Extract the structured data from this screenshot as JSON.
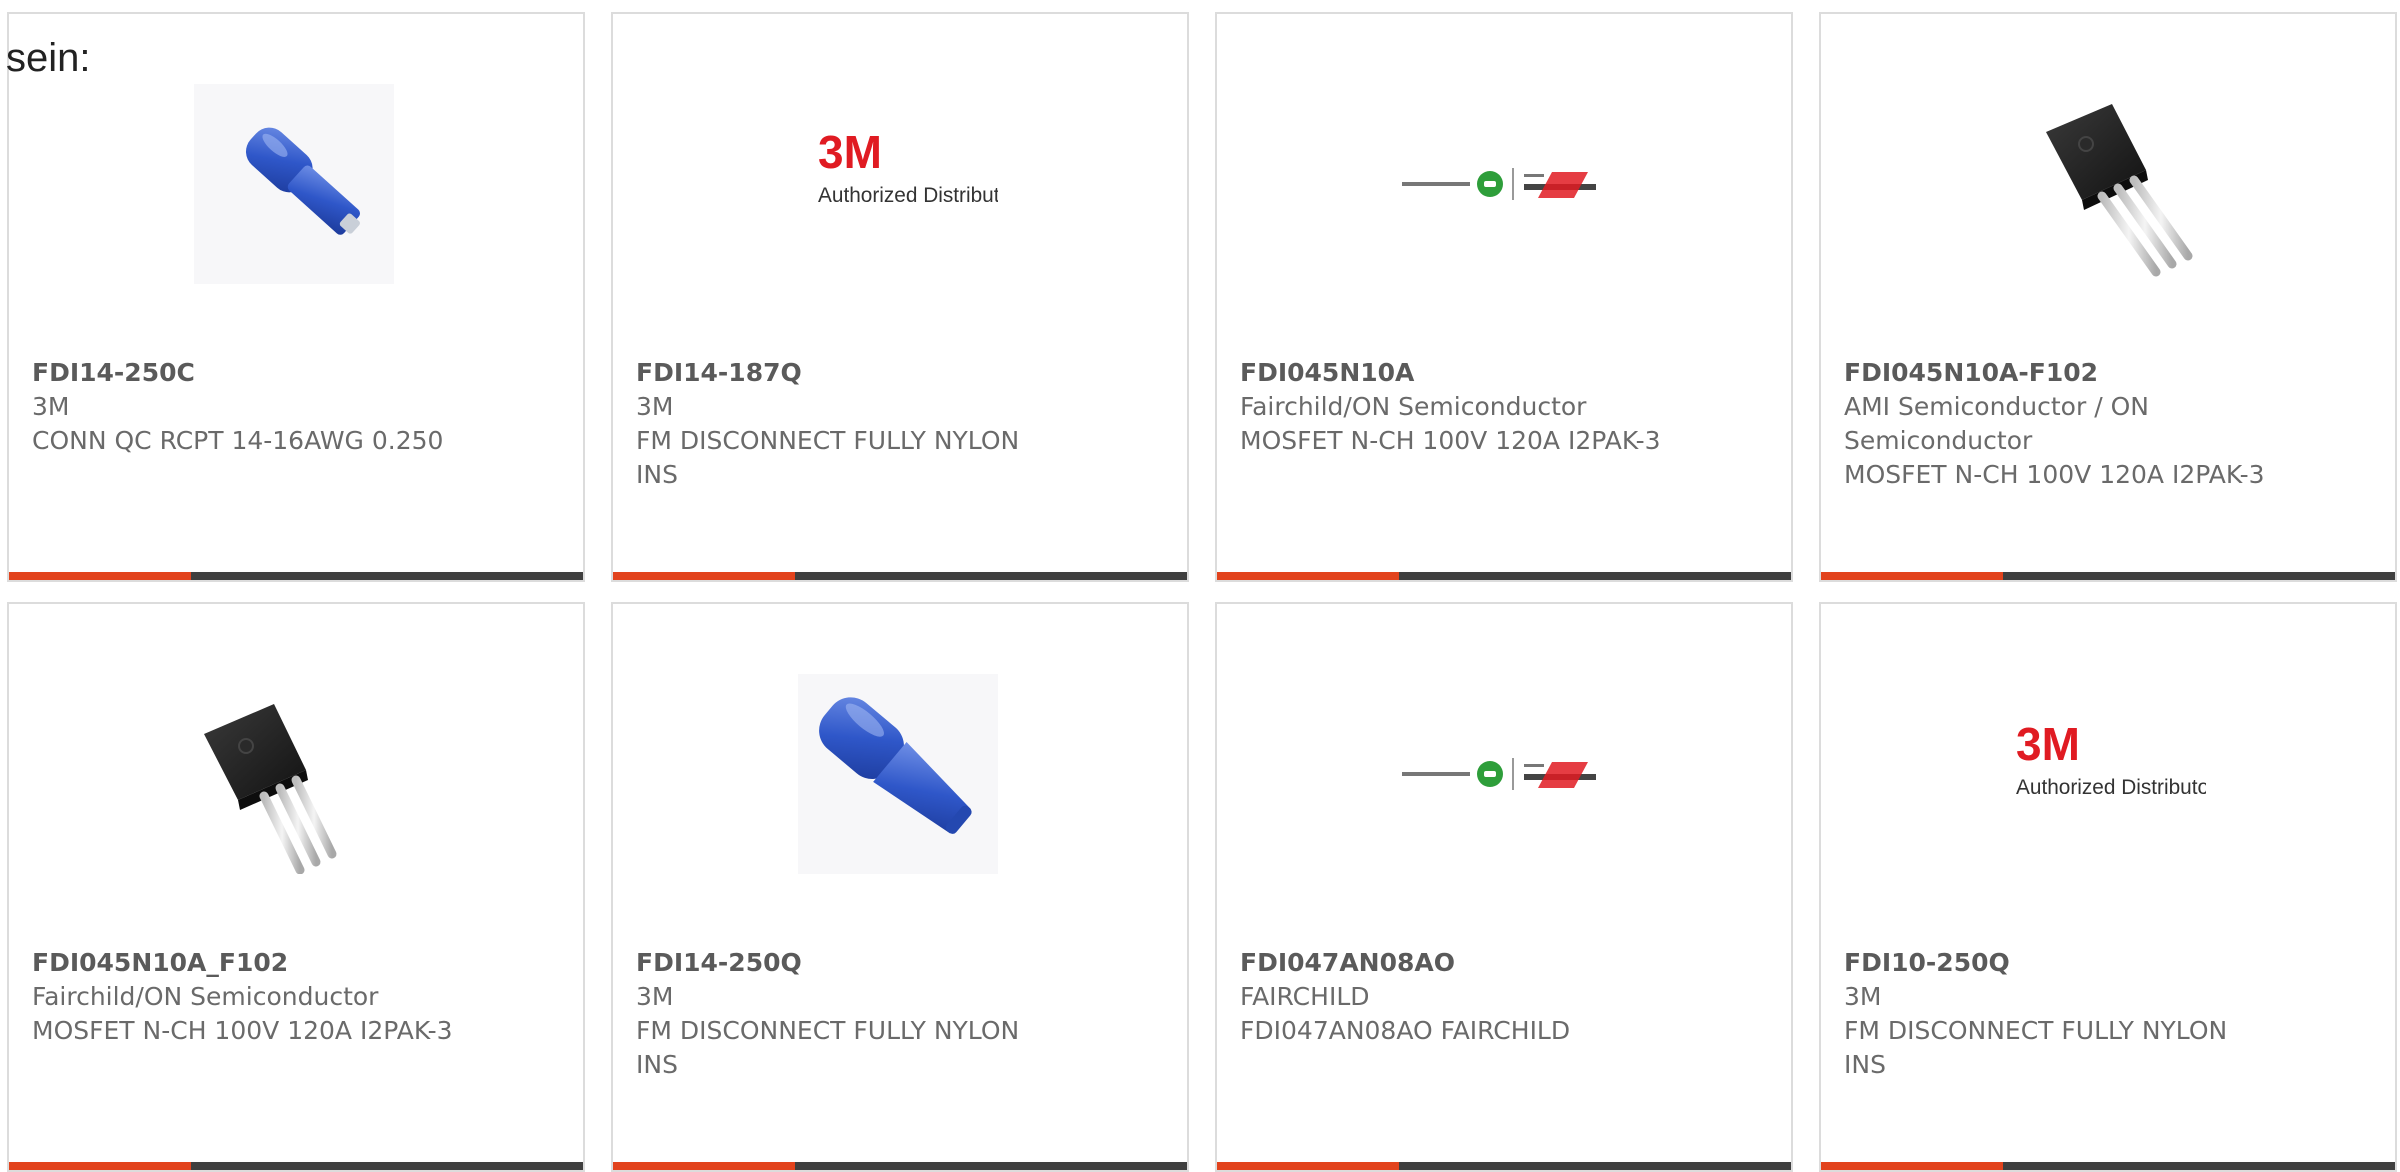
{
  "lead_text": "sein:",
  "colors": {
    "accent": "#e2431d",
    "bar_dark": "#3f3f3f",
    "card_border": "#dcdcdc",
    "text": "#6a6a6a"
  },
  "products": [
    {
      "part": "FDI14-250C",
      "manufacturer": "3M",
      "description": "CONN QC RCPT 14-16AWG 0.250",
      "image": "blue-quick-connect-receptacle"
    },
    {
      "part": "FDI14-187Q",
      "manufacturer": "3M",
      "description": "FM DISCONNECT FULLY NYLON INS",
      "image": "3m-authorized-distributor-logo",
      "logo_mark": "3M",
      "logo_text": "Authorized Distributor"
    },
    {
      "part": "FDI045N10A",
      "manufacturer": "Fairchild/ON Semiconductor",
      "description": "MOSFET N-CH 100V 120A I2PAK-3",
      "image": "on-semiconductor-fairchild-logo"
    },
    {
      "part": "FDI045N10A-F102",
      "manufacturer": "AMI Semiconductor / ON Semiconductor",
      "description": "MOSFET N-CH 100V 120A I2PAK-3",
      "image": "i2pak-transistor"
    },
    {
      "part": "FDI045N10A_F102",
      "manufacturer": "Fairchild/ON Semiconductor",
      "description": "MOSFET N-CH 100V 120A I2PAK-3",
      "image": "i2pak-transistor"
    },
    {
      "part": "FDI14-250Q",
      "manufacturer": "3M",
      "description": "FM DISCONNECT FULLY NYLON INS",
      "image": "blue-nylon-disconnect"
    },
    {
      "part": "FDI047AN08AO",
      "manufacturer": "FAIRCHILD",
      "description": "FDI047AN08AO FAIRCHILD",
      "image": "on-semiconductor-fairchild-logo"
    },
    {
      "part": "FDI10-250Q",
      "manufacturer": "3M",
      "description": "FM DISCONNECT FULLY NYLON INS",
      "image": "3m-authorized-distributor-logo",
      "logo_mark": "3M",
      "logo_text": "Authorized Distributor"
    }
  ]
}
